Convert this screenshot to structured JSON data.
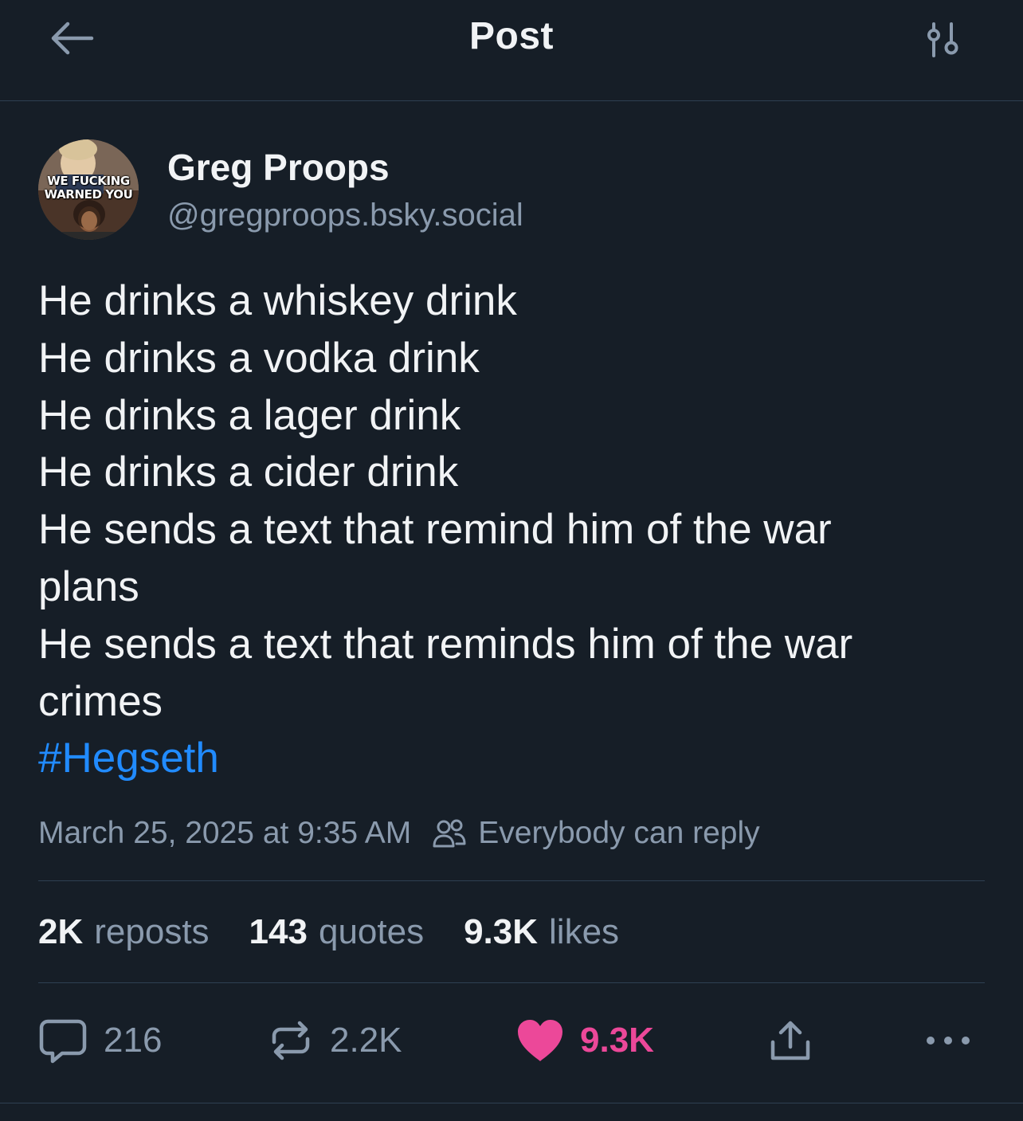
{
  "header": {
    "title": "Post",
    "back_icon": "arrow-left-icon",
    "filter_icon": "sliders-icon"
  },
  "author": {
    "display_name": "Greg Proops",
    "handle": "@gregproops.bsky.social",
    "avatar_text": [
      "WE FUCKING",
      "WARNED YOU"
    ]
  },
  "post": {
    "lines": [
      "He drinks a whiskey drink",
      "He drinks a vodka drink",
      "He drinks a lager drink",
      "He drinks a cider drink",
      "He sends a text that remind him of the war",
      "plans",
      "He sends a text that reminds him of the war",
      "crimes"
    ],
    "hashtag": "#Hegseth",
    "hashtag_color": "#218bff"
  },
  "meta": {
    "timestamp": "March 25, 2025 at 9:35 AM",
    "reply_setting": "Everybody can reply",
    "reply_icon": "people-icon"
  },
  "stats": {
    "reposts_count": "2K",
    "reposts_label": "reposts",
    "quotes_count": "143",
    "quotes_label": "quotes",
    "likes_count": "9.3K",
    "likes_label": "likes"
  },
  "actions": {
    "reply_count": "216",
    "repost_count": "2.2K",
    "like_count": "9.3K",
    "like_color": "#ec4899"
  },
  "colors": {
    "background": "#161e27",
    "text": "#f1f3f5",
    "muted": "#8a9aad",
    "border": "#2e4052"
  }
}
